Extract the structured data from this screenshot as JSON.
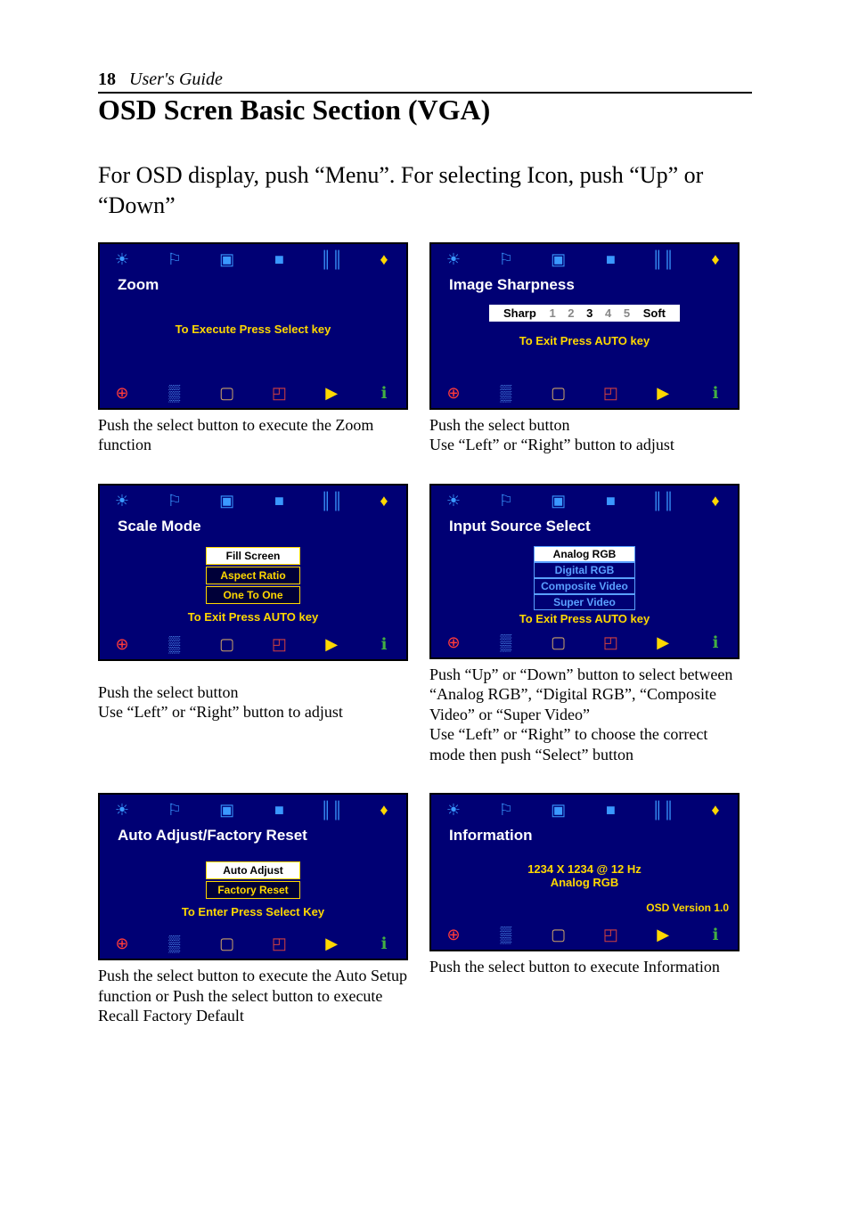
{
  "header": {
    "page_number": "18",
    "guide": "User's Guide"
  },
  "section_title": "OSD Scren Basic Section (VGA)",
  "intro": "For OSD display, push “Menu”.  For selecting Icon, push “Up” or “Down”",
  "panels": {
    "zoom": {
      "title": "Zoom",
      "hint": "To Execute Press Select key",
      "caption": "Push the select button to execute the Zoom function"
    },
    "sharpness": {
      "title": "Image   Sharpness",
      "left_label": "Sharp",
      "right_label": "Soft",
      "scale": [
        "1",
        "2",
        "3",
        "4",
        "5"
      ],
      "hint": "To Exit Press AUTO key",
      "caption": "Push the select button\nUse “Left” or “Right” button to adjust"
    },
    "scale": {
      "title": "Scale   Mode",
      "options": [
        "Fill Screen",
        "Aspect Ratio",
        "One To One"
      ],
      "hint": "To Exit Press AUTO key",
      "caption": "Push the select button\nUse “Left” or “Right” button to adjust"
    },
    "input": {
      "title": "Input   Source   Select",
      "options": [
        "Analog RGB",
        "Digital RGB",
        "Composite Video",
        "Super Video"
      ],
      "hint": "To Exit Press AUTO key",
      "caption": "Push “Up” or “Down” button to select between “Analog RGB”, “Digital RGB”, “Composite Video” or “Super Video”\nUse “Left” or “Right” to choose the correct mode then push “Select” button"
    },
    "auto": {
      "title": "Auto   Adjust/Factory   Reset",
      "options": [
        "Auto Adjust",
        "Factory Reset"
      ],
      "hint": "To Enter Press Select Key",
      "caption": "Push the select button to execute the Auto Setup function or Push the select button to execute Recall Factory Default"
    },
    "info": {
      "title": "Information",
      "resolution": "1234   X   1234   @   12 Hz",
      "mode": "Analog RGB",
      "version": "OSD Version 1.0",
      "caption": "Push the select button to execute Information"
    }
  },
  "top_icons": [
    "☀",
    "⚐",
    "▣",
    "■",
    "║║",
    "♦"
  ],
  "bottom_icons": [
    "⊕",
    "▒",
    "▢",
    "◰",
    "▶",
    "ℹ"
  ]
}
